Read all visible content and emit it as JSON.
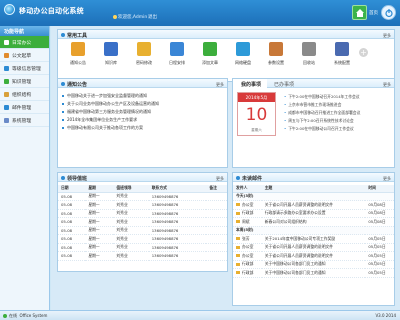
{
  "header": {
    "title": "移动办公自动化系统",
    "welcome": "欢迎您,Admin",
    "logout": "退出",
    "home_label": "首页"
  },
  "sidebar": {
    "title": "功能导航",
    "items": [
      {
        "label": "日常办公",
        "icon": "desk-icon",
        "color": "#ffffff",
        "active": true
      },
      {
        "label": "公文起草",
        "icon": "document-icon",
        "color": "#e08a2c"
      },
      {
        "label": "等级信息管理",
        "icon": "grid-icon",
        "color": "#2d8bd3"
      },
      {
        "label": "知识管理",
        "icon": "book-icon",
        "color": "#3cae3c"
      },
      {
        "label": "组织结构",
        "icon": "org-icon",
        "color": "#d8a03a"
      },
      {
        "label": "邮件管理",
        "icon": "mail-icon",
        "color": "#2d8bd3"
      },
      {
        "label": "系统管理",
        "icon": "gear-icon",
        "color": "#6a8ac8"
      }
    ]
  },
  "tools": {
    "title": "常用工具",
    "more": "更多",
    "items": [
      {
        "label": "通知公告",
        "icon": "bullhorn-icon",
        "color": "#e8a02c"
      },
      {
        "label": "知识库",
        "icon": "library-icon",
        "color": "#3a70c8"
      },
      {
        "label": "密码修改",
        "icon": "lock-icon",
        "color": "#e8b030"
      },
      {
        "label": "日程安排",
        "icon": "calendar-icon",
        "color": "#3a86d6"
      },
      {
        "label": "添加文章",
        "icon": "add-article-icon",
        "color": "#3cae3c"
      },
      {
        "label": "网络硬盘",
        "icon": "globe-disk-icon",
        "color": "#2d9ad8"
      },
      {
        "label": "参数设置",
        "icon": "tools-icon",
        "color": "#c87838"
      },
      {
        "label": "回收站",
        "icon": "trash-icon",
        "color": "#8a8a8a"
      },
      {
        "label": "系统配置",
        "icon": "settings-icon",
        "color": "#4a6ab0"
      }
    ]
  },
  "notices": {
    "title": "通知公告",
    "more": "更多",
    "items": [
      "中国移动关于进一步加强安全监督管理的通知",
      "关于公司业务中国移动办公生产区及设备运营的通知",
      "福建省中国移动第三方服务业务管理情况的通知",
      "2014年全市集团单位业务生产工作要求",
      "中国移动有限公司关于推动各项工作的方案"
    ]
  },
  "schedule": {
    "tab_active": "我的事项",
    "tab_inactive": "已办事项",
    "cal_header": "2014年5月",
    "cal_day": "10",
    "cal_sub": "星期六",
    "more": "更多",
    "items": [
      "下午2:00在中国移动召开2014年工作会议",
      "上京市市营市推工作现场推进会",
      "成都市中国移动召开推进工作全面部署会议",
      "周五与下午2:00召开系统性技术讨论会",
      "下午2:00在中国移动公司召开工作会议"
    ]
  },
  "duty": {
    "title": "领导值班",
    "more": "更多",
    "columns": [
      "日期",
      "星期",
      "值班领导",
      "联系方式",
      "备注"
    ],
    "rows": [
      [
        "05-08",
        "星期一",
        "刘秀业",
        "13609498876",
        ""
      ],
      [
        "05-08",
        "星期一",
        "刘秀业",
        "13609498876",
        ""
      ],
      [
        "05-08",
        "星期一",
        "刘秀业",
        "13609498876",
        ""
      ],
      [
        "05-08",
        "星期一",
        "刘秀业",
        "13609498876",
        ""
      ],
      [
        "05-08",
        "星期一",
        "刘秀业",
        "13609498876",
        ""
      ],
      [
        "05-08",
        "星期一",
        "刘秀业",
        "13609498876",
        ""
      ],
      [
        "05-08",
        "星期一",
        "刘秀业",
        "13609498876",
        ""
      ],
      [
        "05-08",
        "星期一",
        "刘秀业",
        "13609498876",
        ""
      ]
    ]
  },
  "mail": {
    "title": "未读邮件",
    "more": "更多",
    "columns": [
      "发件人",
      "主题",
      "时间"
    ],
    "groups": [
      {
        "label": "今天(3封)",
        "rows": [
          [
            "办公室",
            "关于省公司开展人员薪资调整的说明文件",
            "05月08日"
          ],
          [
            "行政部",
            "行政部请示多路办公室要求办公设置",
            "05月08日"
          ],
          [
            "周斌",
            "新春公司对公司组织结构",
            "05月08日"
          ]
        ]
      },
      {
        "label": "本周(5封)",
        "rows": [
          [
            "张芳",
            "关于2014年度中国移动公司专项工作奖励",
            "05月05日"
          ],
          [
            "办公室",
            "关于省公司开展人员薪资调整的说明文件",
            "05月05日"
          ],
          [
            "办公室",
            "关于省公司开展人员薪资调整的说明文件",
            "05月05日"
          ],
          [
            "行政部",
            "关于中国移动公司各部门员工的通知",
            "05月05日"
          ],
          [
            "行政部",
            "关于中国移动公司各部门员工的通知",
            "05月05日"
          ]
        ]
      }
    ]
  },
  "footer": {
    "status": "在线",
    "system": "Office System",
    "version": "V3.0 2014"
  }
}
